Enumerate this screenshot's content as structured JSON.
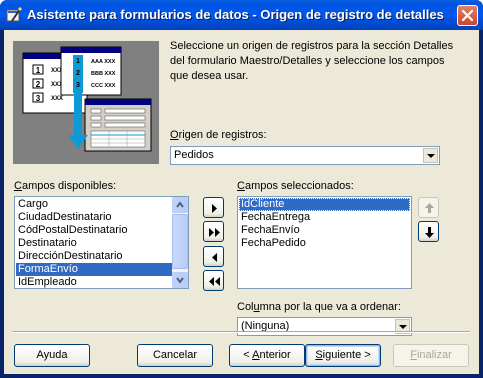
{
  "window": {
    "title": "Asistente para formularios de datos - Origen de registro de detalles",
    "icons": {
      "app": "wizard-wand-icon",
      "close": "close-icon"
    }
  },
  "illustration": {
    "icon": "master-detail-form-illustration",
    "rows": [
      {
        "num": "1",
        "text": "XXX"
      },
      {
        "num": "2",
        "text": "XXX"
      },
      {
        "num": "3",
        "text": "XXX"
      }
    ],
    "detail_rows": [
      {
        "num": "1",
        "text": "AAA XXX"
      },
      {
        "num": "2",
        "text": "BBB XXX"
      },
      {
        "num": "3",
        "text": "CCC XXX"
      }
    ]
  },
  "description": "Seleccione un origen de registros para la sección Detalles del formulario Maestro/Detalles y seleccione los campos que desea usar.",
  "record_source": {
    "label_underlined": "O",
    "label_rest": "rigen de registros:",
    "value": "Pedidos"
  },
  "available_fields": {
    "label_underlined": "C",
    "label_rest": "ampos disponibles:",
    "items": [
      "Cargo",
      "CiudadDestinatario",
      "CódPostalDestinatario",
      "Destinatario",
      "DirecciónDestinatario",
      "FormaEnvío",
      "IdEmpleado"
    ],
    "selected_index": 5
  },
  "selected_fields": {
    "label_underlined": "C",
    "label_rest": "ampos seleccionados:",
    "items": [
      "IdCliente",
      "FechaEntrega",
      "FechaEnvío",
      "FechaPedido"
    ],
    "selected_index": 0
  },
  "move_buttons": {
    "add_one": "arrow-right-icon",
    "add_all": "double-arrow-right-icon",
    "remove_one": "arrow-left-icon",
    "remove_all": "double-arrow-left-icon"
  },
  "order_buttons": {
    "move_up": "arrow-up-icon",
    "move_down": "arrow-down-icon"
  },
  "sort_column": {
    "label_pre": "Col",
    "label_underlined": "u",
    "label_rest": "mna por la que va a ordenar:",
    "value": "(Ninguna)"
  },
  "footer": {
    "help": "Ayuda",
    "cancel": "Cancelar",
    "back_prefix": "< ",
    "back_underlined": "A",
    "back_rest": "nterior",
    "next_underlined": "S",
    "next_rest": "iguiente >",
    "finish_underlined": "F",
    "finish_rest": "inalizar"
  },
  "colors": {
    "titlebar": "#0054e3",
    "dialog_bg": "#ece9d8",
    "selection": "#316ac5"
  }
}
